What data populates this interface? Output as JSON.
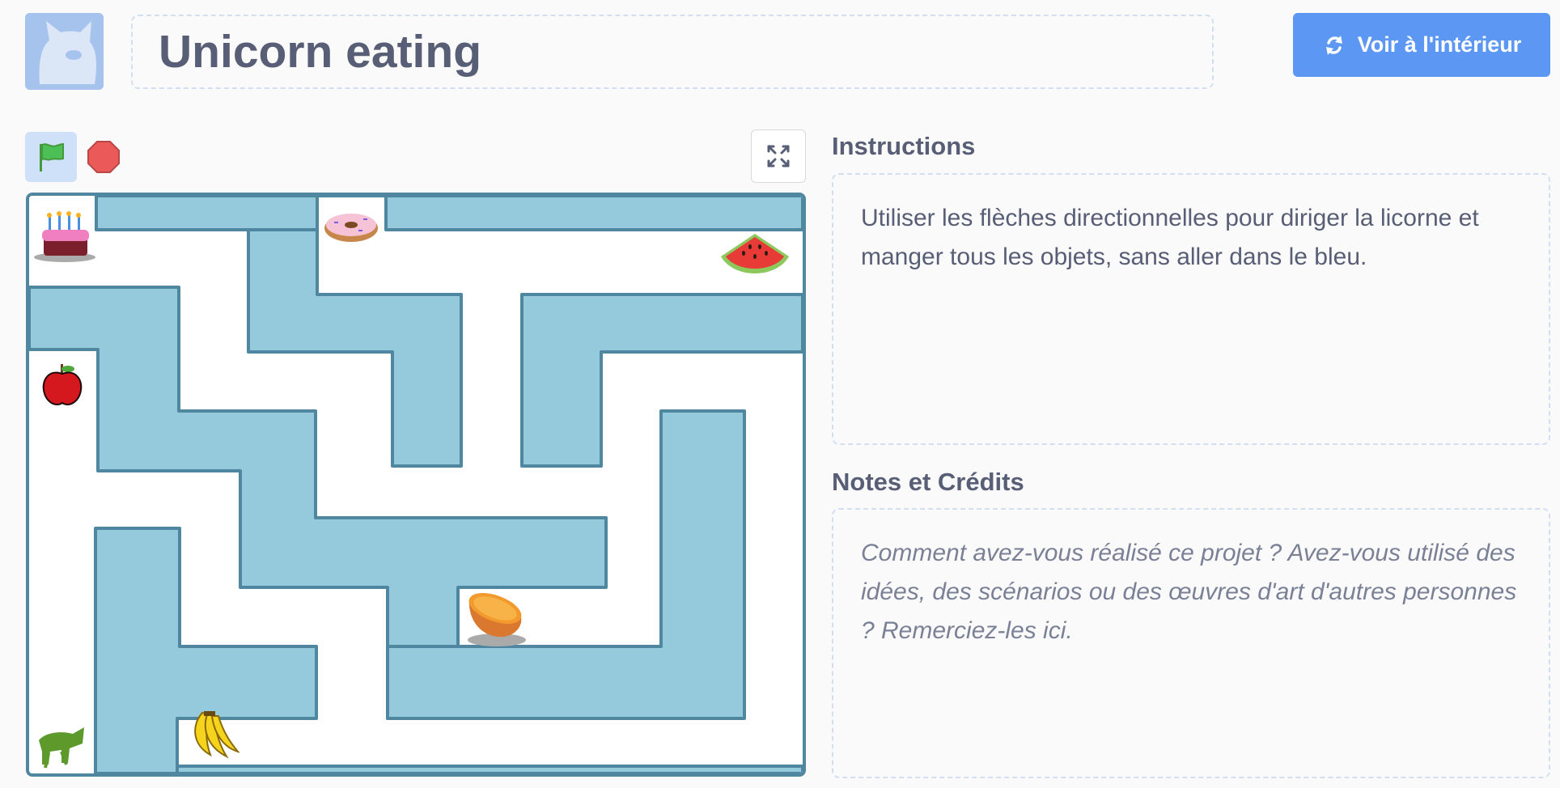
{
  "project": {
    "title": "Unicorn eating",
    "see_inside_label": "Voir à l'intérieur"
  },
  "controls": {
    "green_flag_icon": "green-flag-icon",
    "stop_icon": "stop-icon",
    "fullscreen_icon": "fullscreen-icon"
  },
  "stage": {
    "sprites": [
      "cake",
      "donut",
      "watermelon",
      "apple",
      "orange",
      "banana",
      "unicorn"
    ],
    "colors": {
      "wall_fill": "#94cadc",
      "wall_stroke": "#4f87a1",
      "path": "#ffffff"
    }
  },
  "instructions": {
    "heading": "Instructions",
    "text": "Utiliser les flèches directionnelles pour diriger la licorne et manger tous les objets, sans aller dans le bleu."
  },
  "notes": {
    "heading": "Notes et Crédits",
    "placeholder": "Comment avez-vous réalisé ce projet ? Avez-vous utilisé des idées, des scénarios ou des œuvres d'art d'autres personnes ? Remerciez-les ici."
  },
  "colors": {
    "accent": "#5b97f3",
    "text": "#575e75",
    "dashed_border": "#d3dff1"
  }
}
